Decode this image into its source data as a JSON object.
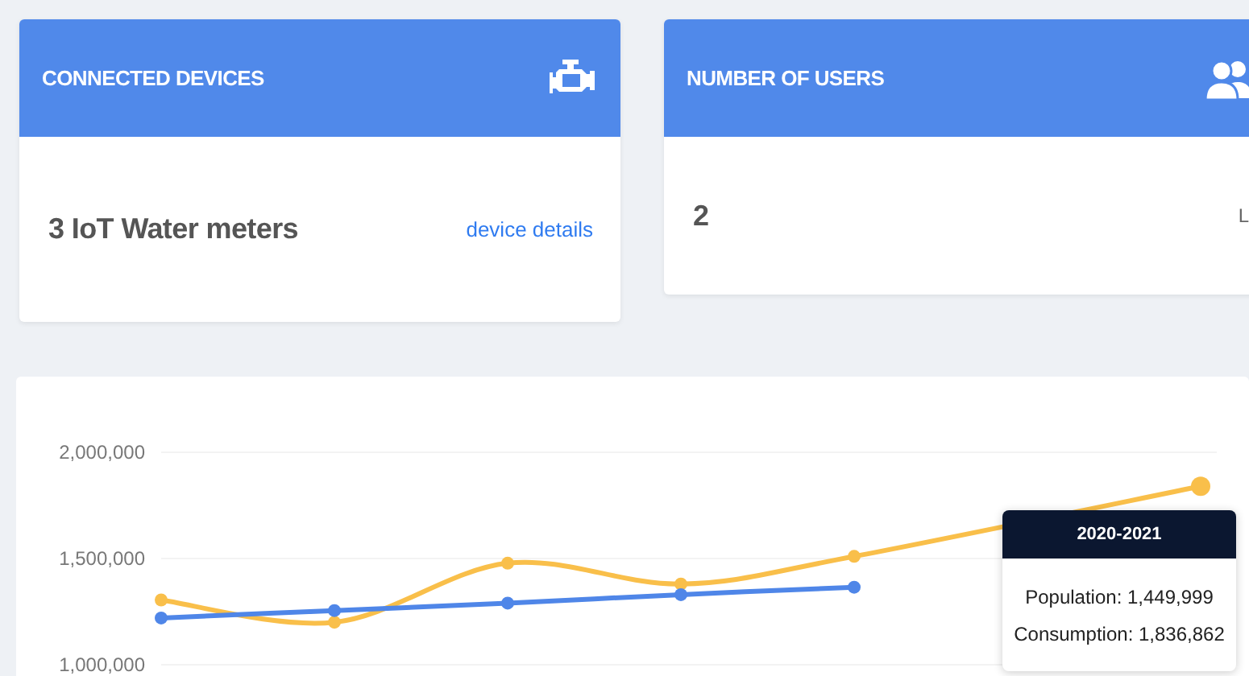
{
  "cards": [
    {
      "title": "CONNECTED DEVICES",
      "value": "3 IoT Water meters",
      "link": "device details"
    },
    {
      "title": "NUMBER OF USERS",
      "value": "2",
      "link": "L"
    }
  ],
  "chart": {
    "chart_data": {
      "type": "line",
      "ylim": [
        1000000,
        2000000
      ],
      "yticks": [
        {
          "value": 1000000,
          "label": "1,000,000"
        },
        {
          "value": 1500000,
          "label": "1,500,000"
        },
        {
          "value": 2000000,
          "label": "2,000,000"
        }
      ],
      "series": [
        {
          "color": "#4f86e8",
          "marker": "circle",
          "values": [
            1220000,
            1255000,
            1290000,
            1330000,
            1365000,
            null,
            null
          ]
        },
        {
          "color": "#f9bf4a",
          "marker": "circle",
          "values": [
            1305000,
            1200000,
            1478000,
            1380000,
            1510000,
            null,
            1840000
          ]
        }
      ]
    },
    "tooltip": {
      "title": "2020-2021",
      "lines": [
        "Population: 1,449,999",
        "Consumption: 1,836,862"
      ]
    }
  }
}
